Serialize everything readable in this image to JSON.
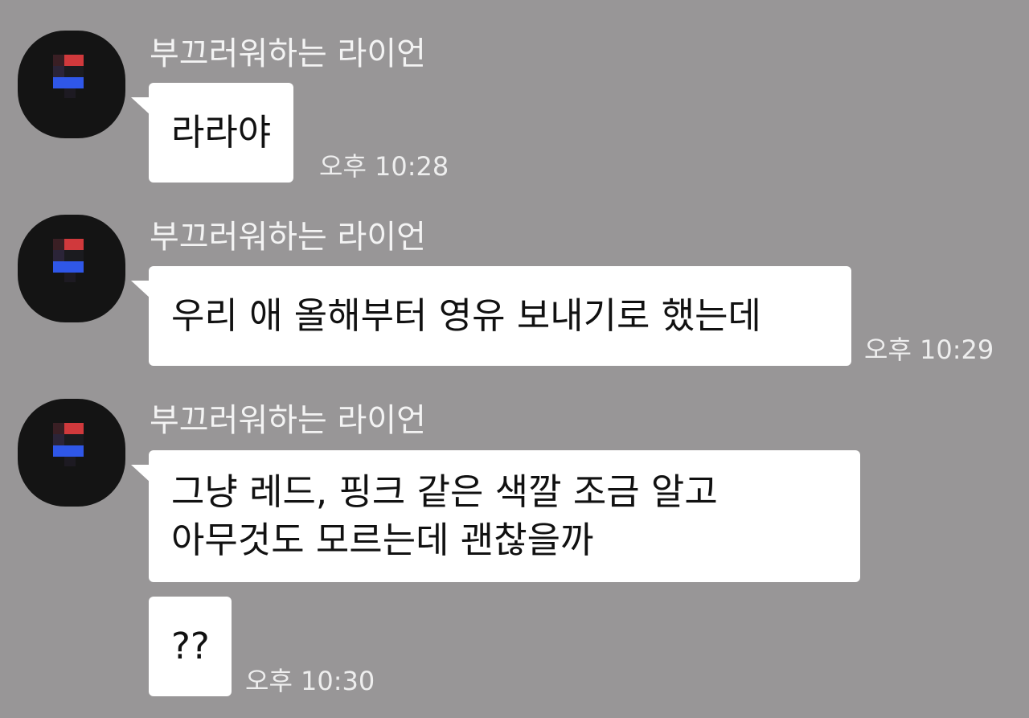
{
  "sender_name": "부끄러워하는 라이언",
  "avatar_icon": "pixelated-profile-icon",
  "colors": {
    "background": "#989697",
    "bubble": "#ffffff",
    "avatar": "#141414",
    "pixel_red": "#d0393c",
    "pixel_blue": "#2f57e8"
  },
  "messages": [
    {
      "sender": "부끄러워하는 라이언",
      "lines": [
        "라라야"
      ],
      "time": "오후 10:28"
    },
    {
      "sender": "부끄러워하는 라이언",
      "lines": [
        "우리 애 올해부터 영유 보내기로 했는데"
      ],
      "time": "오후 10:29"
    },
    {
      "sender": "부끄러워하는 라이언",
      "lines": [
        "그냥 레드, 핑크 같은 색깔 조금 알고",
        "아무것도 모르는데 괜찮을까"
      ],
      "time": ""
    },
    {
      "sender": "",
      "lines": [
        "??"
      ],
      "time": "오후 10:30"
    }
  ]
}
